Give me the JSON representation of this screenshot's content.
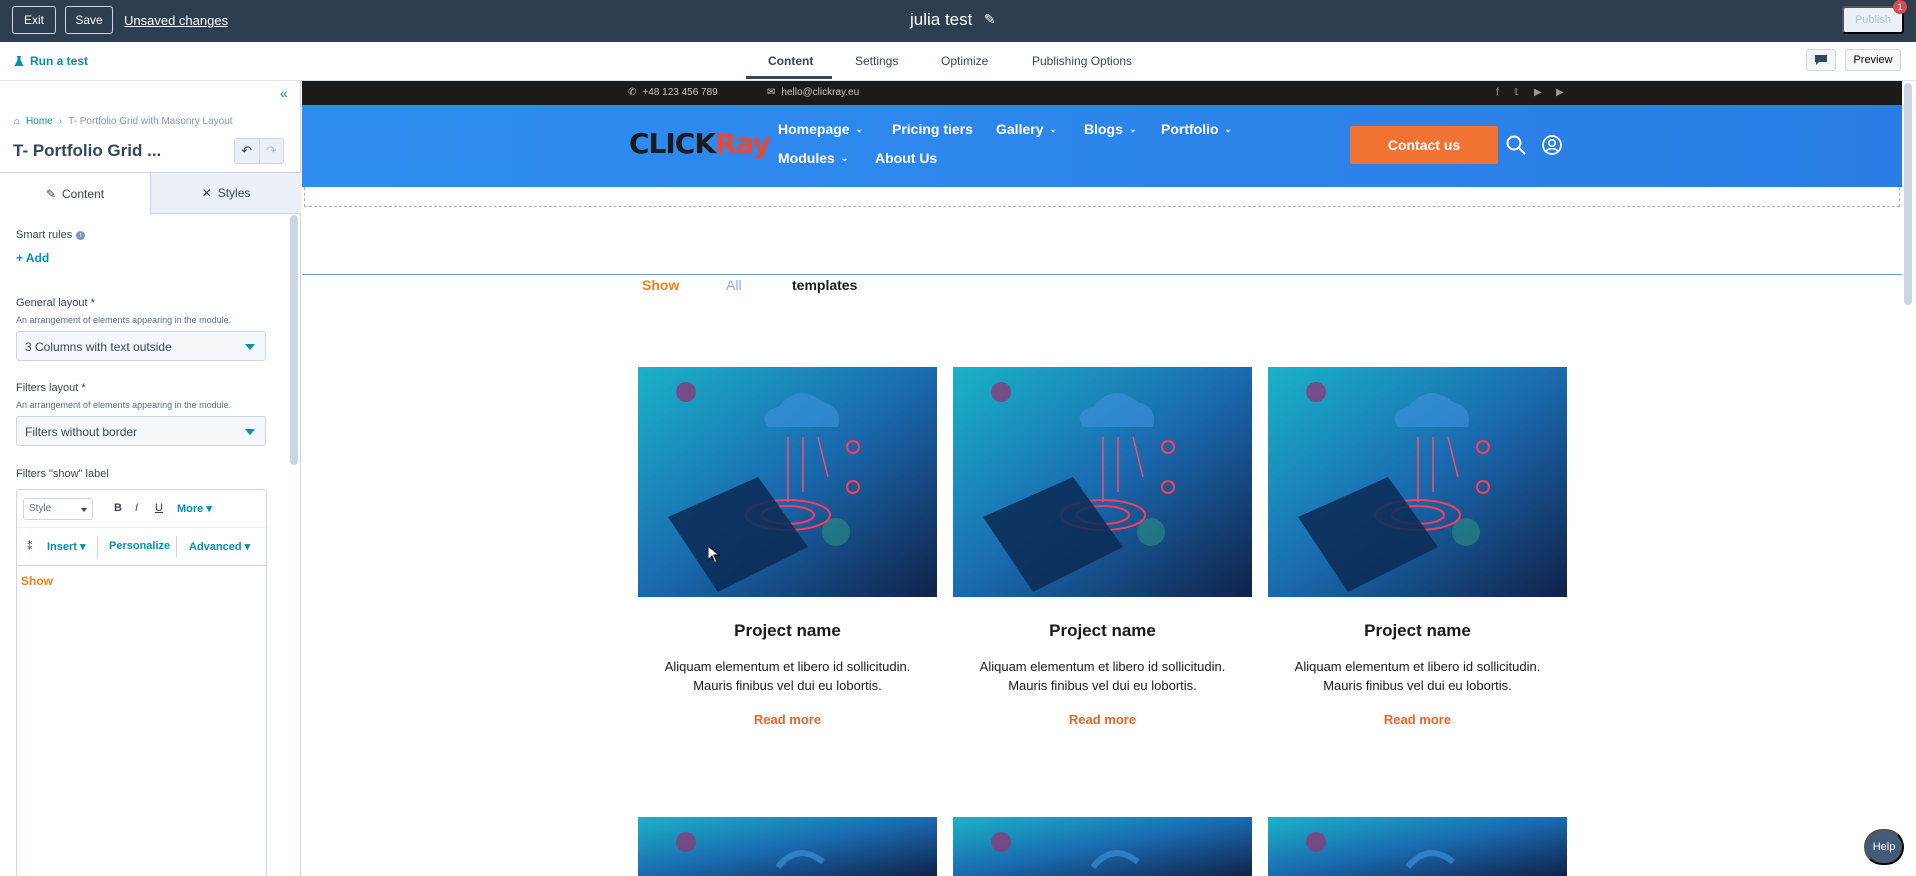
{
  "topbar": {
    "exit_label": "Exit",
    "save_label": "Save",
    "unsaved_label": "Unsaved changes",
    "title": "julia test",
    "publish_label": "Publish",
    "notification_count": "1"
  },
  "subbar": {
    "run_test_label": "Run a test",
    "tabs": [
      {
        "label": "Content",
        "active": true
      },
      {
        "label": "Settings",
        "active": false
      },
      {
        "label": "Optimize",
        "active": false
      },
      {
        "label": "Publishing Options",
        "active": false
      }
    ],
    "preview_label": "Preview"
  },
  "panel": {
    "breadcrumb": {
      "home": "Home",
      "current": "T- Portfolio Grid with Masonry Layout"
    },
    "module_title": "T- Portfolio Grid ...",
    "tabs": [
      {
        "label": "Content",
        "icon": "pencil-icon"
      },
      {
        "label": "Styles",
        "icon": "brush-icon"
      }
    ],
    "smart_rules_label": "Smart rules",
    "add_label": "Add",
    "general_layout": {
      "label": "General layout *",
      "help": "An arrangement of elements appearing in the module.",
      "value": "3 Columns with text outside"
    },
    "filters_layout": {
      "label": "Filters layout *",
      "help": "An arrangement of elements appearing in the module.",
      "value": "Filters without border"
    },
    "show_label_field": {
      "label": "Filters \"show\" label",
      "style_placeholder": "Style",
      "bold": "B",
      "italic": "I",
      "underline": "U",
      "more": "More",
      "insert": "Insert",
      "personalize": "Personalize",
      "advanced": "Advanced",
      "content": "Show"
    }
  },
  "site": {
    "phone": "+48 123 456 789",
    "email": "hello@clickray.eu",
    "logo_left": "CLICK",
    "logo_right": "Ray",
    "nav": [
      {
        "label": "Homepage",
        "dropdown": true
      },
      {
        "label": "Pricing tiers",
        "dropdown": false
      },
      {
        "label": "Gallery",
        "dropdown": true
      },
      {
        "label": "Blogs",
        "dropdown": true
      },
      {
        "label": "Portfolio",
        "dropdown": true
      },
      {
        "label": "Modules",
        "dropdown": true
      },
      {
        "label": "About Us",
        "dropdown": false
      }
    ],
    "contact_label": "Contact us",
    "filters": {
      "show": "Show",
      "all": "All",
      "templates": "templates"
    },
    "cards": [
      {
        "title": "Project name",
        "desc1": "Aliquam elementum et libero id sollicitudin.",
        "desc2": "Mauris finibus vel dui eu lobortis.",
        "link": "Read more"
      },
      {
        "title": "Project name",
        "desc1": "Aliquam elementum et libero id sollicitudin.",
        "desc2": "Mauris finibus vel dui eu lobortis.",
        "link": "Read more"
      },
      {
        "title": "Project name",
        "desc1": "Aliquam elementum et libero id sollicitudin.",
        "desc2": "Mauris finibus vel dui eu lobortis.",
        "link": "Read more"
      }
    ]
  },
  "help_label": "Help",
  "colors": {
    "topbar": "#2d3e50",
    "accent": "#0091ae",
    "orange": "#f07333",
    "site_blue": "#2f8df0"
  }
}
